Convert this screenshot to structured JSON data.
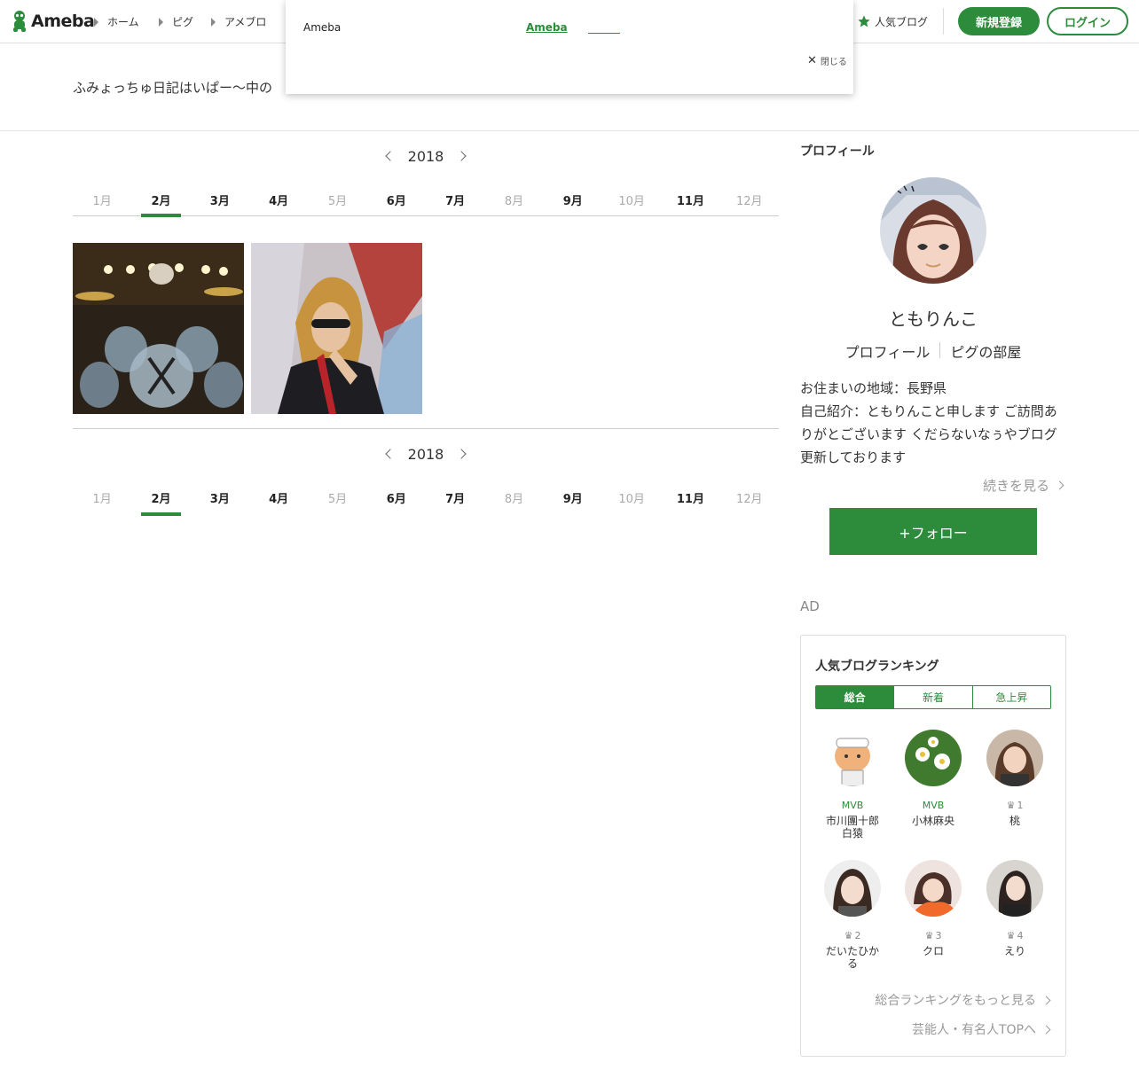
{
  "header": {
    "logo_text": "Ameba",
    "nav": [
      "ホーム",
      "ピグ",
      "アメブロ"
    ],
    "popular_label": "人気ブログ",
    "signup_label": "新規登録",
    "login_label": "ログイン",
    "brand_color": "#2d8c3c"
  },
  "popup": {
    "left_text": "Ameba",
    "link_text": "Ameba",
    "close_label": "閉じる"
  },
  "blog": {
    "title": "ふみょっちゅ日記はいぱー〜中の"
  },
  "archive": {
    "year": "2018",
    "months": [
      {
        "label": "1月",
        "state": "dim"
      },
      {
        "label": "2月",
        "state": "active"
      },
      {
        "label": "3月",
        "state": "bold"
      },
      {
        "label": "4月",
        "state": "bold"
      },
      {
        "label": "5月",
        "state": "dim"
      },
      {
        "label": "6月",
        "state": "bold"
      },
      {
        "label": "7月",
        "state": "bold"
      },
      {
        "label": "8月",
        "state": "dim"
      },
      {
        "label": "9月",
        "state": "bold"
      },
      {
        "label": "10月",
        "state": "dim"
      },
      {
        "label": "11月",
        "state": "bold"
      },
      {
        "label": "12月",
        "state": "dim"
      }
    ],
    "photos": [
      "drummer-photo",
      "sunglasses-portrait-photo"
    ]
  },
  "profile": {
    "heading": "プロフィール",
    "name": "ともりんこ",
    "link_profile": "プロフィール",
    "link_pigg": "ピグの部屋",
    "location": "お住まいの地域：長野県",
    "intro": "自己紹介：ともりんこと申します ご訪問ありがとございます くだらないなぅやブログ更新しております",
    "read_more": "続きを見る",
    "follow_label": "+フォロー"
  },
  "ad_label": "AD",
  "ranking": {
    "title": "人気ブログランキング",
    "tabs": [
      "総合",
      "新着",
      "急上昇"
    ],
    "items": [
      {
        "badge": "MVB",
        "name": "市川團十郎白猿"
      },
      {
        "badge": "MVB",
        "name": "小林麻央"
      },
      {
        "badge": "1",
        "name": "桃"
      },
      {
        "badge": "2",
        "name": "だいたひかる"
      },
      {
        "badge": "3",
        "name": "クロ"
      },
      {
        "badge": "4",
        "name": "えり"
      }
    ],
    "more_link": "総合ランキングをもっと見る",
    "top_link": "芸能人・有名人TOPへ"
  }
}
